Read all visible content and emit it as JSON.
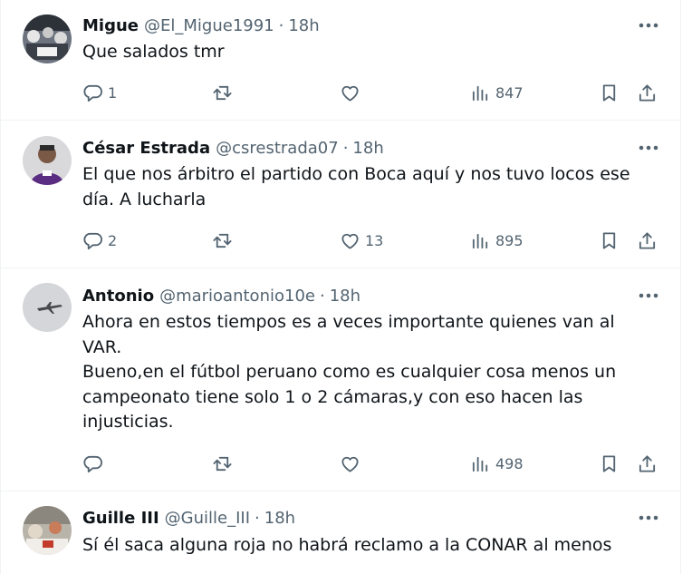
{
  "tweets": [
    {
      "name": "Migue",
      "handle": "@El_Migue1991",
      "time": "18h",
      "lines": [
        "Que salados tmr"
      ],
      "replies": "1",
      "retweets": "",
      "likes": "",
      "views": "847"
    },
    {
      "name": "César Estrada",
      "handle": "@csrestrada07",
      "time": "18h",
      "lines": [
        "El que nos árbitro el partido con Boca aquí y nos tuvo locos ese",
        "día. A lucharla"
      ],
      "replies": "2",
      "retweets": "",
      "likes": "13",
      "views": "895"
    },
    {
      "name": "Antonio",
      "handle": "@marioantonio10e",
      "time": "18h",
      "lines": [
        "Ahora en estos tiempos es a veces importante quienes van al",
        "VAR.",
        "Bueno,en el fútbol peruano como es cualquier cosa menos un",
        "campeonato tiene solo 1 o 2 cámaras,y con eso hacen las",
        "injusticias."
      ],
      "replies": "",
      "retweets": "",
      "likes": "",
      "views": "498"
    },
    {
      "name": "Guille III",
      "handle": "@Guille_III",
      "time": "18h",
      "lines": [
        "Sí él saca alguna roja no habrá reclamo a la CONAR al menos"
      ],
      "replies": "",
      "retweets": "",
      "likes": "",
      "views": ""
    }
  ],
  "separator": "·",
  "icons": {
    "more": "more-horizontal-icon",
    "reply": "reply-icon",
    "retweet": "retweet-icon",
    "like": "heart-icon",
    "views": "views-chart-icon",
    "bookmark": "bookmark-icon",
    "share": "share-icon"
  },
  "colors": {
    "text": "#0f1419",
    "secondary": "#536471",
    "border": "#eff3f4"
  }
}
